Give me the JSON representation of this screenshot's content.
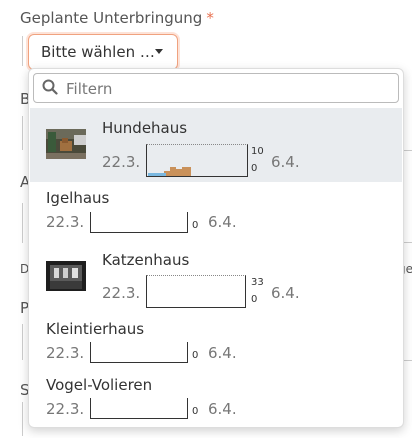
{
  "field": {
    "label": "Geplante Unterbringung",
    "required_mark": "*"
  },
  "select": {
    "value": "Bitte wählen …"
  },
  "background_letters": [
    "B",
    "A",
    "D",
    "ge",
    "P",
    "S"
  ],
  "filter": {
    "placeholder": "Filtern"
  },
  "options": [
    {
      "name": "Hundehaus",
      "start": "22.3.",
      "end": "6.4.",
      "max": "10",
      "min": "0",
      "thumb": "dog-photo",
      "occupancy": [
        2,
        4,
        4,
        3,
        5,
        5,
        2,
        2
      ]
    },
    {
      "name": "Igelhaus",
      "start": "22.3.",
      "end": "6.4.",
      "min": "0"
    },
    {
      "name": "Katzenhaus",
      "start": "22.3.",
      "end": "6.4.",
      "max": "33",
      "min": "0",
      "thumb": "cat-house-photo"
    },
    {
      "name": "Kleintierhaus",
      "start": "22.3.",
      "end": "6.4.",
      "min": "0"
    },
    {
      "name": "Vogel-Volieren",
      "start": "22.3.",
      "end": "6.4.",
      "min": "0"
    }
  ],
  "colors": {
    "accent": "#e8704f",
    "bar": "#c9915a",
    "line": "#7ab8e0",
    "highlight": "#e9ecef"
  }
}
